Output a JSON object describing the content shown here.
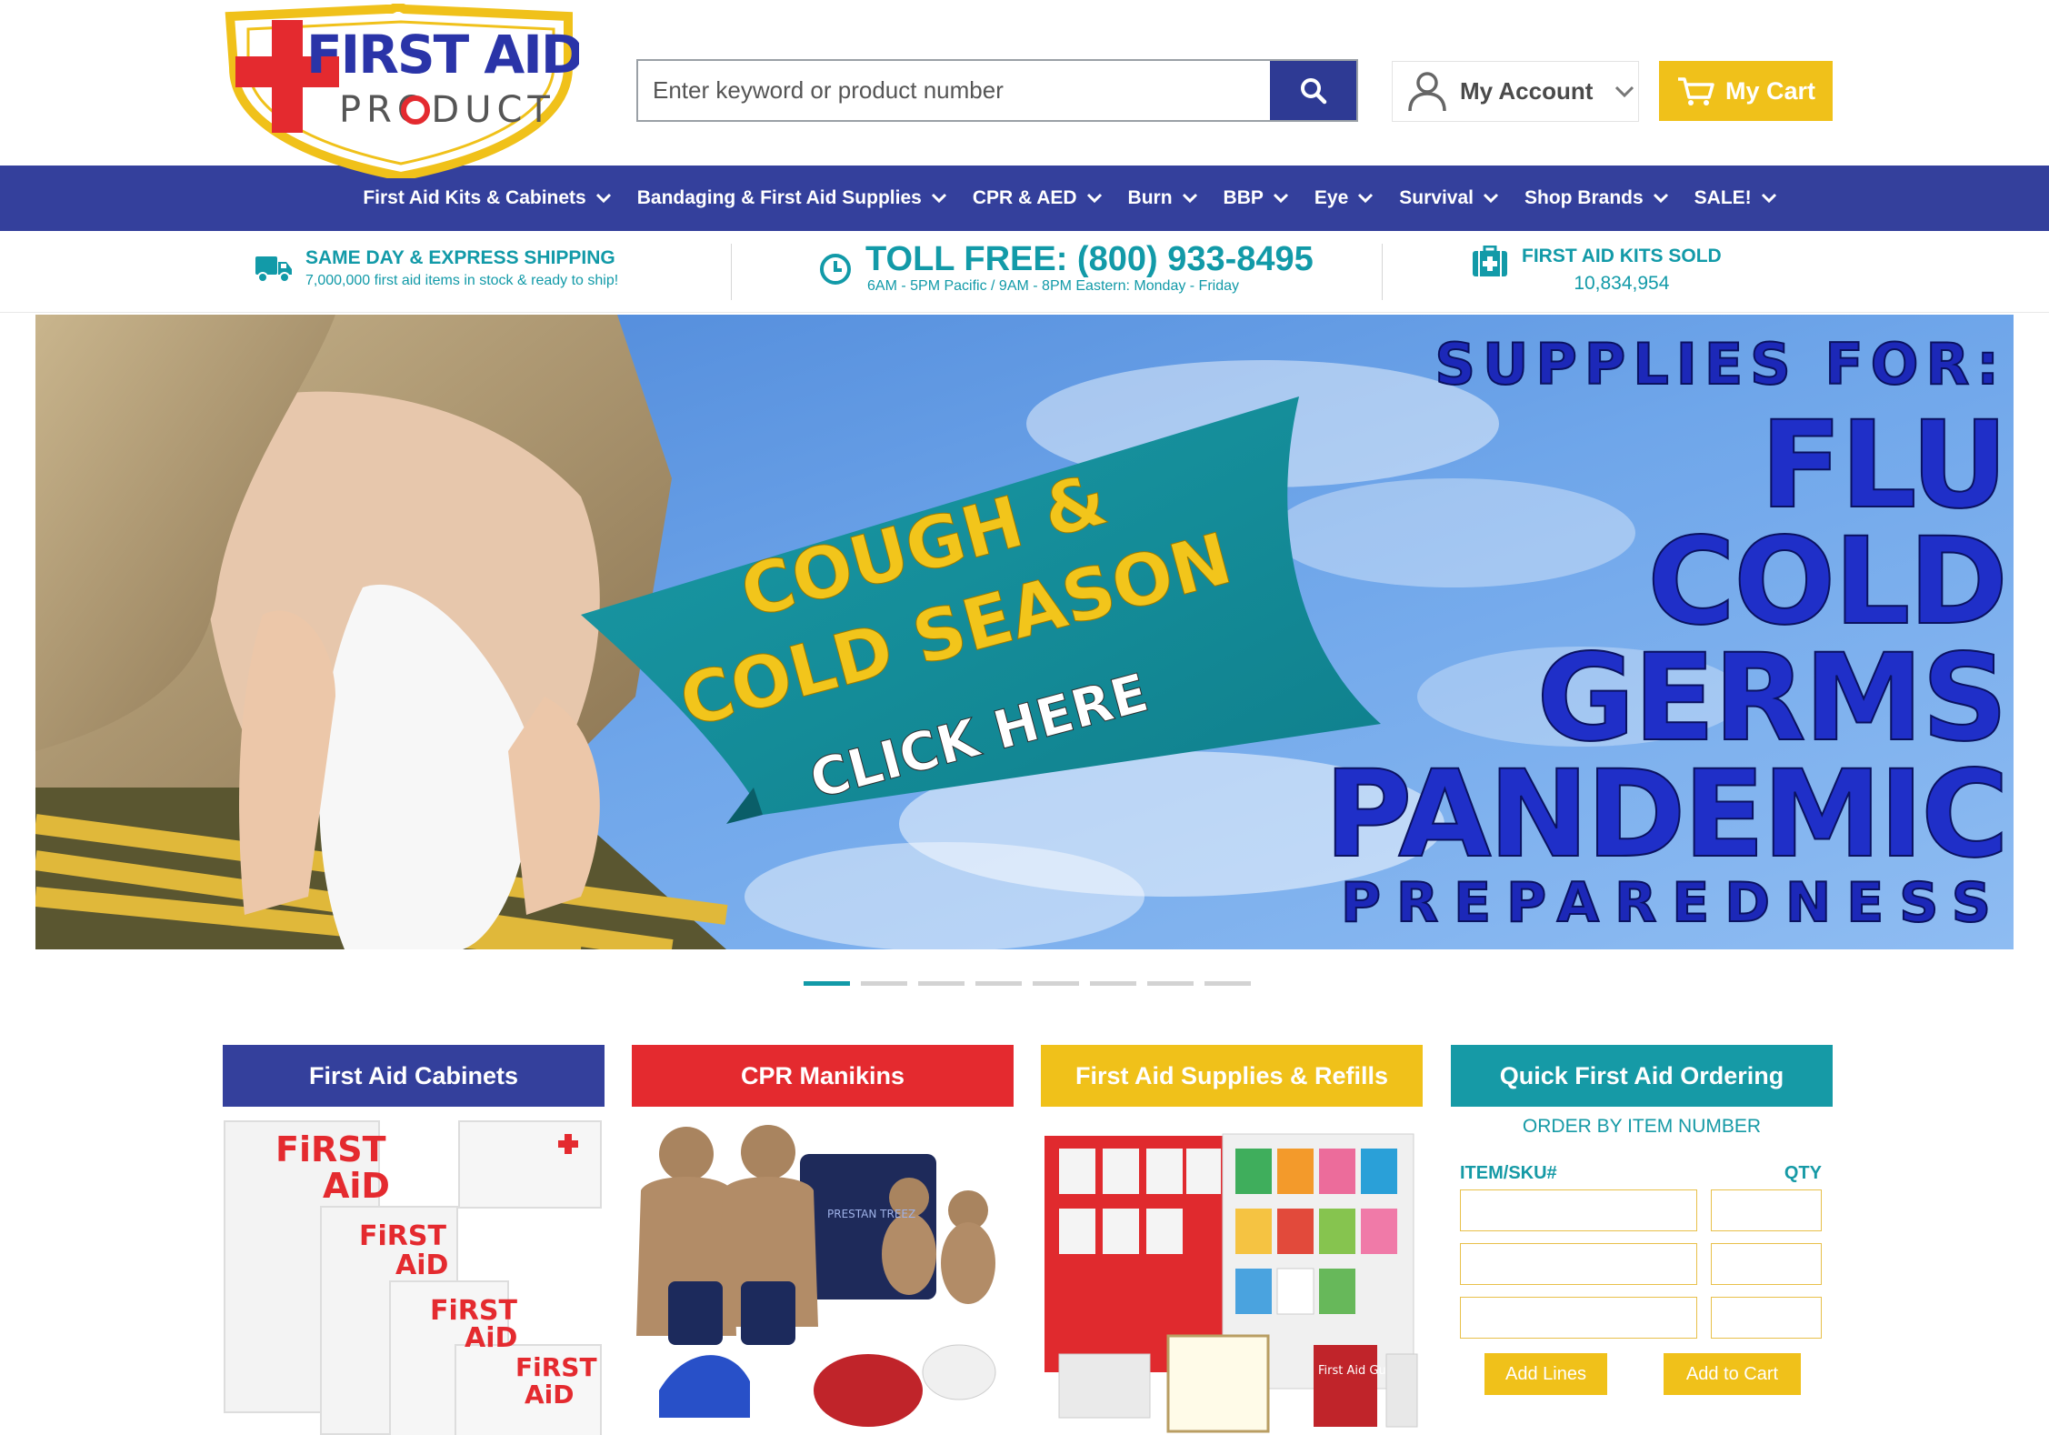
{
  "brand": {
    "logo_line1": "FIRST AID",
    "logo_line2": "PRODUCT",
    "colors": {
      "blue": "#34409c",
      "teal": "#169aa6",
      "yellow": "#f0c11a",
      "red": "#e42a2f"
    }
  },
  "header": {
    "search_placeholder": "Enter keyword or product number",
    "search_icon": "search-icon",
    "account_label": "My Account",
    "account_icon": "user-icon",
    "cart_label": "My Cart",
    "cart_icon": "cart-icon"
  },
  "nav": {
    "items": [
      {
        "label": "First Aid Kits & Cabinets"
      },
      {
        "label": "Bandaging & First Aid Supplies"
      },
      {
        "label": "CPR & AED"
      },
      {
        "label": "Burn"
      },
      {
        "label": "BBP"
      },
      {
        "label": "Eye"
      },
      {
        "label": "Survival"
      },
      {
        "label": "Shop Brands"
      },
      {
        "label": "SALE!"
      }
    ]
  },
  "infobar": {
    "shipping_title": "SAME DAY & EXPRESS SHIPPING",
    "shipping_sub": "7,000,000 first aid items in stock & ready to ship!",
    "phone_title": "TOLL FREE: (800) 933-8495",
    "phone_hours": "6AM - 5PM Pacific / 9AM - 8PM Eastern: Monday - Friday",
    "kits_title": "FIRST AID KITS SOLD",
    "kits_count": "10,834,954"
  },
  "hero": {
    "banner_line1": "COUGH &",
    "banner_line2": "COLD SEASON",
    "banner_cta": "CLICK HERE",
    "headline_top": "SUPPLIES FOR:",
    "headline_lines": [
      "FLU",
      "COLD",
      "GERMS",
      "PANDEMIC"
    ],
    "headline_bottom": "PREPAREDNESS",
    "slides": 8,
    "active_slide": 1
  },
  "categories": [
    {
      "title": "First Aid Cabinets",
      "color": "#34409c",
      "image_text": "FIRST AID"
    },
    {
      "title": "CPR Manikins",
      "color": "#e42a2f",
      "image_text": "PRESTAN TREEZ"
    },
    {
      "title": "First Aid Supplies & Refills",
      "color": "#f0c11a",
      "image_text": "First Aid Guide"
    }
  ],
  "quick_order": {
    "title": "Quick First Aid Ordering",
    "subtitle": "ORDER BY ITEM NUMBER",
    "col_sku": "ITEM/SKU#",
    "col_qty": "QTY",
    "add_lines": "Add Lines",
    "add_to_cart": "Add to Cart"
  }
}
